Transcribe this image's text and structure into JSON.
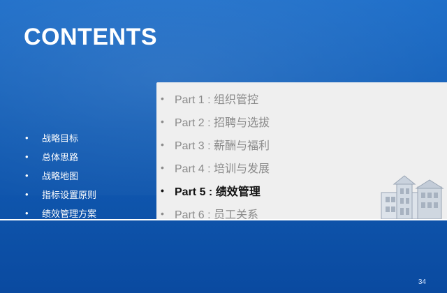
{
  "title": "CONTENTS",
  "left_items": [
    "战略目标",
    "总体思路",
    "战略地图",
    "指标设置原则",
    "绩效管理方案"
  ],
  "panel_items": [
    {
      "label": "Part 1 : 组织管控",
      "active": false
    },
    {
      "label": "Part 2 : 招聘与选拔",
      "active": false
    },
    {
      "label": "Part 3 : 薪酬与福利",
      "active": false
    },
    {
      "label": "Part 4 : 培训与发展",
      "active": false
    },
    {
      "label": "Part 5 : 绩效管理",
      "active": true
    },
    {
      "label": "Part 6 : 员工关系",
      "active": false
    }
  ],
  "bullet_char": "•",
  "page_number": "34",
  "colors": {
    "background": "#125cb4",
    "panel": "#efefef",
    "active_text": "#111111",
    "inactive_text": "#8b8b8b"
  }
}
